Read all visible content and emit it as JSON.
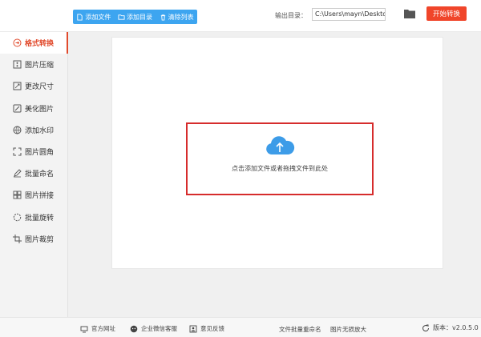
{
  "toolbar": {
    "add_file": "添加文件",
    "add_dir": "添加目录",
    "clear_list": "清除列表",
    "output_label": "输出目录：",
    "output_path": "C:\\Users\\mayn\\Desktop",
    "start": "开始转换"
  },
  "sidebar": {
    "items": [
      {
        "label": "格式转换",
        "icon": "convert-icon"
      },
      {
        "label": "图片压缩",
        "icon": "compress-icon"
      },
      {
        "label": "更改尺寸",
        "icon": "resize-icon"
      },
      {
        "label": "美化图片",
        "icon": "beautify-icon"
      },
      {
        "label": "添加水印",
        "icon": "watermark-icon"
      },
      {
        "label": "图片圆角",
        "icon": "round-corner-icon"
      },
      {
        "label": "批量命名",
        "icon": "rename-icon"
      },
      {
        "label": "图片拼接",
        "icon": "stitch-icon"
      },
      {
        "label": "批量旋转",
        "icon": "rotate-icon"
      },
      {
        "label": "图片裁剪",
        "icon": "crop-icon"
      }
    ],
    "active_index": 0
  },
  "dropzone": {
    "text": "点击添加文件或者拖拽文件到此处",
    "icon": "upload-cloud-icon"
  },
  "bottom": {
    "website": "官方网址",
    "wechat": "企业微信客服",
    "feedback": "意见反馈",
    "batch_rename": "文件批量重命名",
    "lossless_zoom": "图片无损放大",
    "version": "版本：v2.0.5.0"
  },
  "colors": {
    "accent_blue": "#3da5f0",
    "start_red": "#f0452a",
    "active_red": "#e14a2c",
    "dropzone_border": "#d62c2c",
    "cloud_blue": "#3d9ce8"
  }
}
